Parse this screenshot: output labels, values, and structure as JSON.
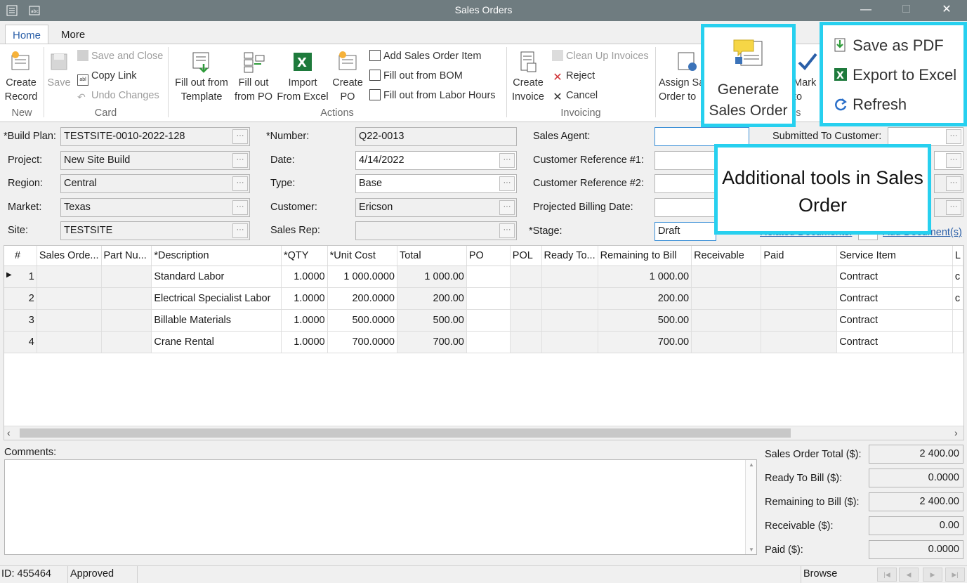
{
  "window": {
    "title": "Sales Orders"
  },
  "tabs": [
    {
      "label": "Home"
    },
    {
      "label": "More"
    }
  ],
  "ribbon": {
    "new": {
      "create_record": "Create Record",
      "group": "New"
    },
    "card": {
      "save": "Save",
      "save_close": "Save and Close",
      "copy_link": "Copy Link",
      "undo": "Undo Changes",
      "group": "Card"
    },
    "actions": {
      "fill_template": "Fill out from Template",
      "fill_po": "Fill out from PO",
      "import_excel": "Import From Excel",
      "create_po": "Create PO",
      "add_item": "Add Sales Order Item",
      "fill_bom": "Fill out from BOM",
      "fill_labor": "Fill out from Labor Hours",
      "group": "Actions"
    },
    "invoicing": {
      "create_invoice": "Create Invoice",
      "clean_up": "Clean Up Invoices",
      "reject": "Reject",
      "cancel": "Cancel",
      "group": "Invoicing"
    },
    "tools": {
      "assign": "Assign Sa Order to",
      "mark": "Mark ady to",
      "group": "ols"
    }
  },
  "callouts": {
    "generate": "Generate Sales Order",
    "save_pdf": "Save as PDF",
    "export_excel": "Export to Excel",
    "refresh": "Refresh",
    "note": "Additional tools in Sales Order"
  },
  "form": {
    "build_plan": {
      "label": "*Build Plan:",
      "value": "TESTSITE-0010-2022-128"
    },
    "project": {
      "label": "Project:",
      "value": "New Site Build"
    },
    "region": {
      "label": "Region:",
      "value": "Central"
    },
    "market": {
      "label": "Market:",
      "value": "Texas"
    },
    "site": {
      "label": "Site:",
      "value": "TESTSITE"
    },
    "number": {
      "label": "*Number:",
      "value": "Q22-0013"
    },
    "date": {
      "label": "Date:",
      "value": "4/14/2022"
    },
    "type": {
      "label": "Type:",
      "value": "Base"
    },
    "customer": {
      "label": "Customer:",
      "value": "Ericson"
    },
    "sales_rep": {
      "label": "Sales Rep:",
      "value": ""
    },
    "sales_agent": {
      "label": "Sales Agent:",
      "value": ""
    },
    "cust_ref1": {
      "label": "Customer Reference #1:",
      "value": ""
    },
    "cust_ref2": {
      "label": "Customer Reference #2:",
      "value": ""
    },
    "proj_billing": {
      "label": "Projected Billing Date:",
      "value": ""
    },
    "stage": {
      "label": "*Stage:",
      "value": "Draft"
    },
    "submitted": {
      "label": "Submitted To Customer:",
      "value": ""
    },
    "related_docs": "Related Documents:",
    "add_docs": "Add Document(s)"
  },
  "grid": {
    "columns": [
      "#",
      "Sales Orde...",
      "Part Nu...",
      "*Description",
      "*QTY",
      "*Unit Cost",
      "Total",
      "PO",
      "POL",
      "Ready To...",
      "Remaining to Bill",
      "Receivable",
      "Paid",
      "Service Item",
      "L"
    ],
    "rows": [
      {
        "num": "1",
        "desc": "Standard Labor",
        "qty": "1.0000",
        "unit": "1 000.0000",
        "total": "1 000.00",
        "remain": "1 000.00",
        "service": "Contract",
        "l": "c"
      },
      {
        "num": "2",
        "desc": "Electrical Specialist Labor",
        "qty": "1.0000",
        "unit": "200.0000",
        "total": "200.00",
        "remain": "200.00",
        "service": "Contract",
        "l": "c"
      },
      {
        "num": "3",
        "desc": "Billable Materials",
        "qty": "1.0000",
        "unit": "500.0000",
        "total": "500.00",
        "remain": "500.00",
        "service": "Contract",
        "l": ""
      },
      {
        "num": "4",
        "desc": "Crane Rental",
        "qty": "1.0000",
        "unit": "700.0000",
        "total": "700.00",
        "remain": "700.00",
        "service": "Contract",
        "l": ""
      }
    ]
  },
  "comments": {
    "label": "Comments:",
    "value": ""
  },
  "totals": {
    "so_total": {
      "label": "Sales Order Total ($):",
      "value": "2 400.00"
    },
    "ready": {
      "label": "Ready To Bill ($):",
      "value": "0.0000"
    },
    "remaining": {
      "label": "Remaining to Bill ($):",
      "value": "2 400.00"
    },
    "receivable": {
      "label": "Receivable ($):",
      "value": "0.00"
    },
    "paid": {
      "label": "Paid ($):",
      "value": "0.0000"
    }
  },
  "status": {
    "id": "ID: 455464",
    "state": "Approved",
    "mode": "Browse"
  },
  "colors": {
    "accent": "#2a5fa8",
    "callout": "#27d0ef",
    "titlebar": "#6f7c80"
  }
}
